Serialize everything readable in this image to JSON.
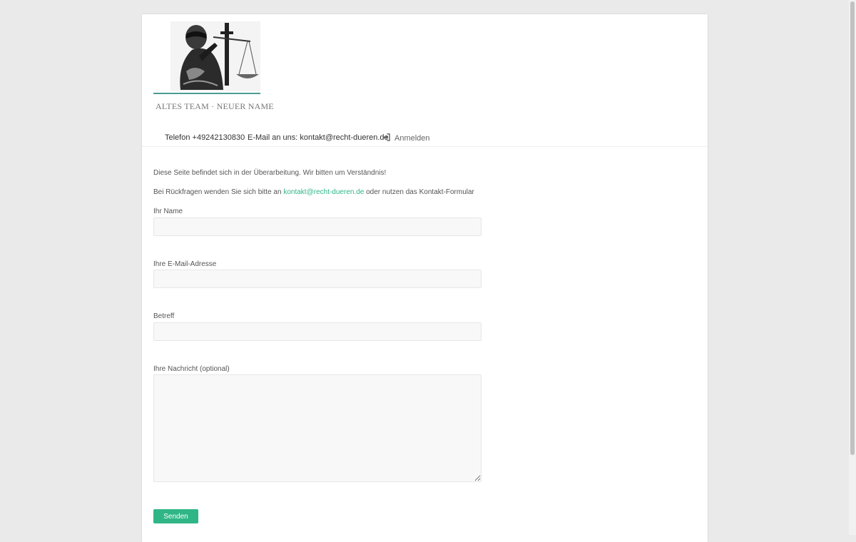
{
  "header": {
    "logo_tagline": "ALTES TEAM · NEUER NAME"
  },
  "topbar": {
    "phone": "Telefon +49242130830",
    "email": "E-Mail an uns: kontakt@recht-dueren.de",
    "login": "Anmelden"
  },
  "main": {
    "notice": "Diese Seite befindet sich in der Überarbeitung. Wir bitten um Verständnis!",
    "contact_prefix": "Bei Rückfragen wenden Sie sich bitte an ",
    "contact_link": "kontakt@recht-dueren.de",
    "contact_suffix": " oder nutzen das Kontakt-Formular"
  },
  "form": {
    "name_label": "Ihr Name",
    "name_value": "",
    "email_label": "Ihre E-Mail-Adresse",
    "email_value": "",
    "subject_label": "Betreff",
    "subject_value": "",
    "message_label": "Ihre Nachricht (optional)",
    "message_value": "",
    "submit_label": "Senden"
  },
  "colors": {
    "accent": "#30b686",
    "logo_line": "#4a9c96",
    "background": "#eaeaea"
  },
  "icons": {
    "login": "sign-in-icon"
  }
}
